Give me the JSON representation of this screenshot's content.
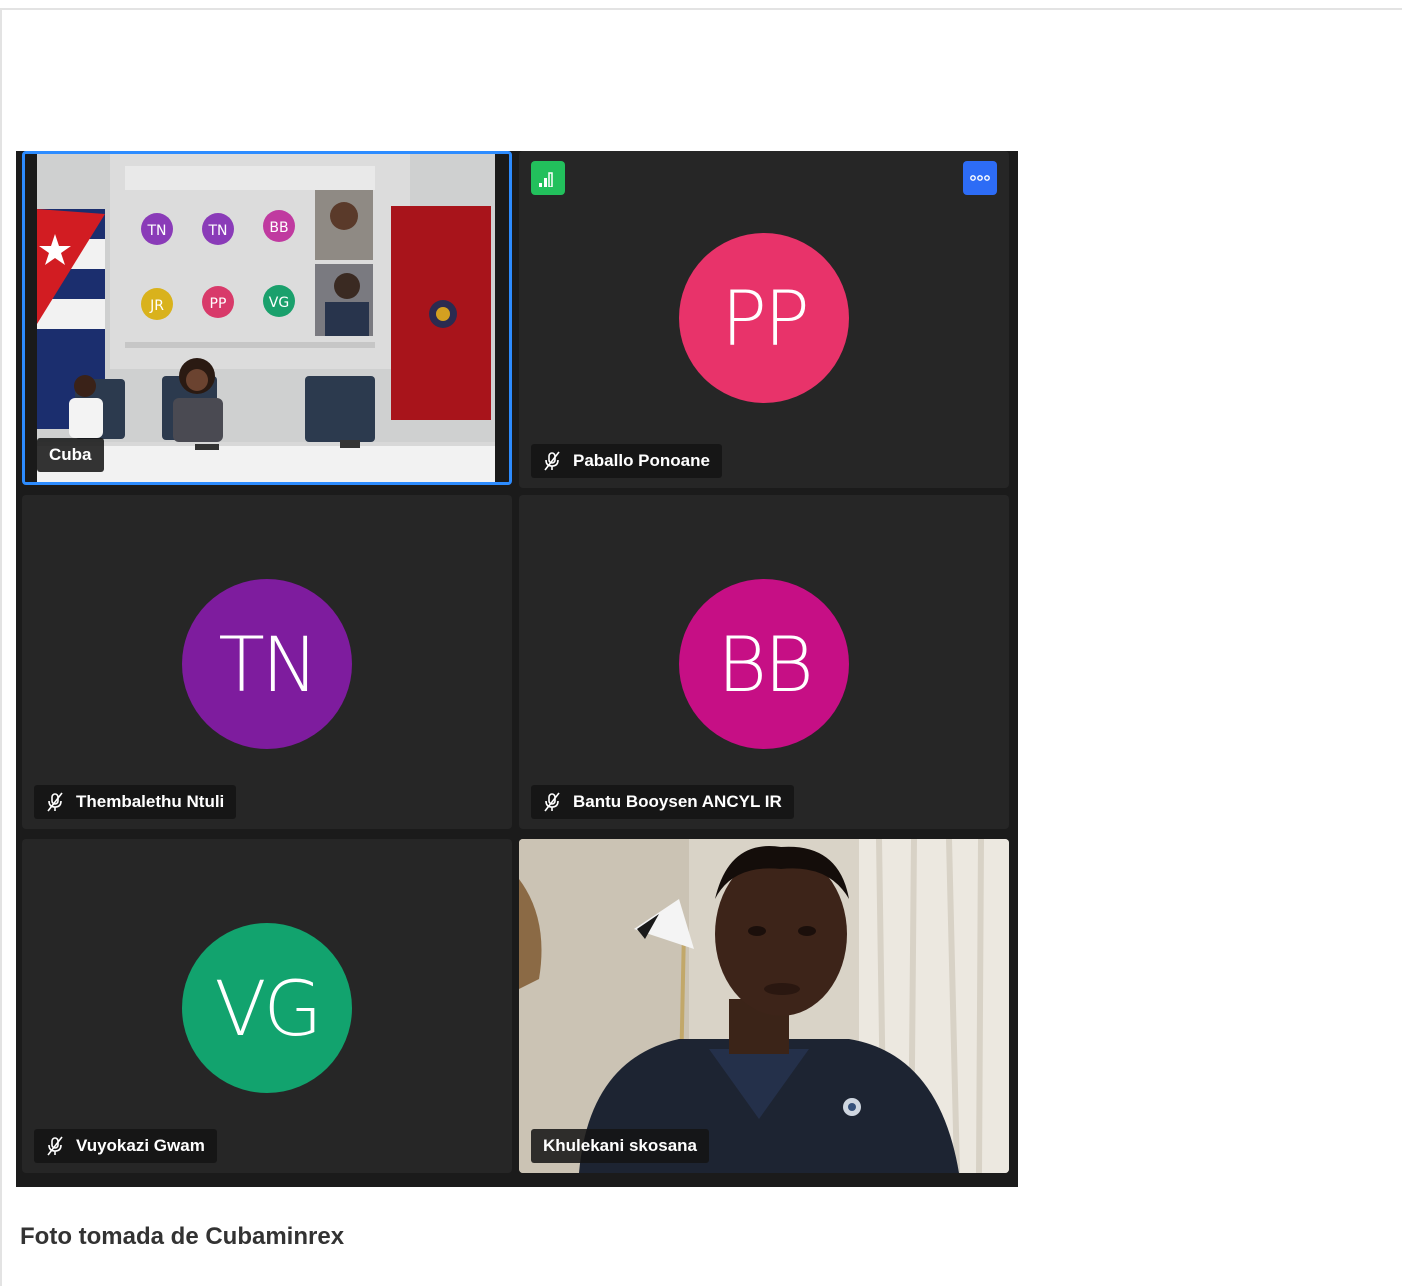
{
  "participants": [
    {
      "name": "Cuba",
      "type": "video",
      "muted": false,
      "active": true
    },
    {
      "name": "Paballo Ponoane",
      "initials": "PP",
      "color": "#e8336a",
      "muted": true
    },
    {
      "name": "Thembalethu Ntuli",
      "initials": "TN",
      "color": "#7e1c9e",
      "muted": true
    },
    {
      "name": "Bantu Booysen ANCYL IR",
      "initials": "BB",
      "color": "#c60f85",
      "muted": true
    },
    {
      "name": "Vuyokazi Gwam",
      "initials": "VG",
      "color": "#12a36e",
      "muted": true
    },
    {
      "name": "Khulekani skosana",
      "type": "video",
      "muted": false
    }
  ],
  "projected_avatars": [
    "TN",
    "TN",
    "BB",
    "JR",
    "PP",
    "VG"
  ],
  "icons": {
    "signal": "signal-bars-icon",
    "more": "more-options-icon",
    "mute": "muted-microphone-icon"
  },
  "colors": {
    "active_border": "#2d8cff",
    "signal_button": "#22c05c",
    "more_button": "#2d6cf6",
    "tile_background": "#262626"
  },
  "caption": "Foto tomada de Cubaminrex"
}
